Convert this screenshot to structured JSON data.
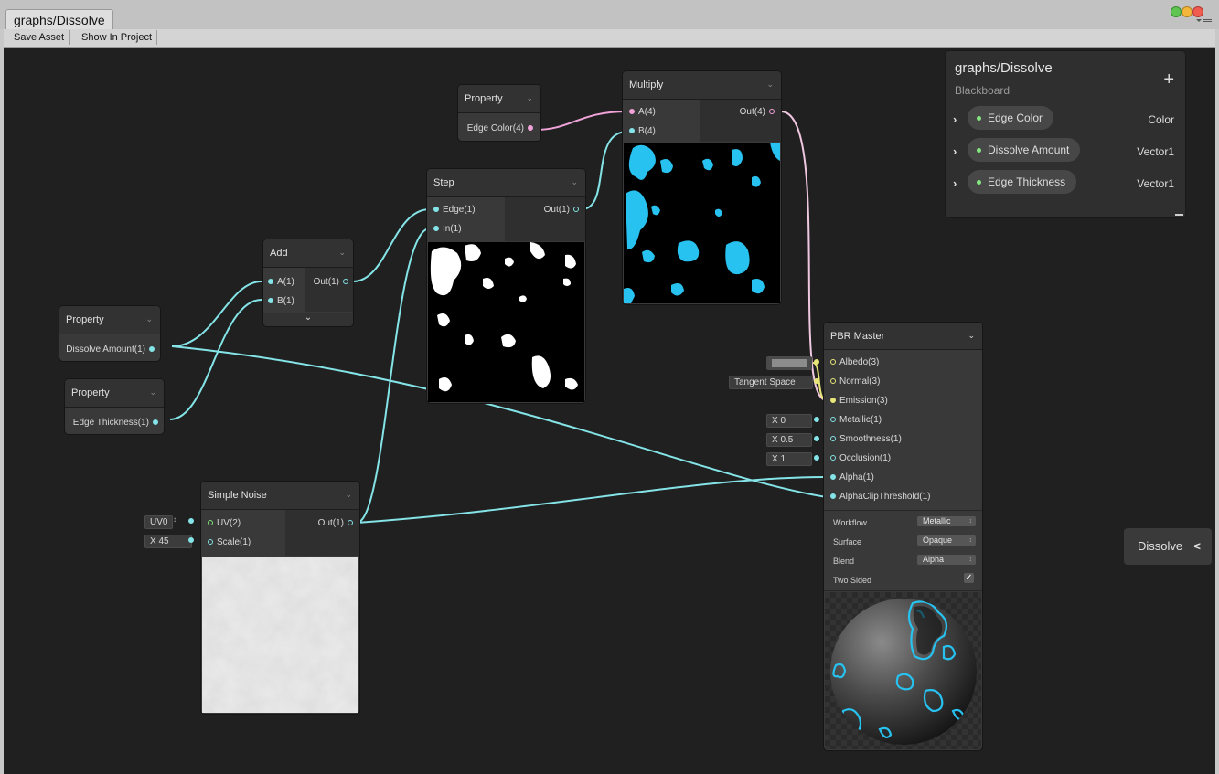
{
  "window": {
    "tab_title": "graphs/Dissolve",
    "controls": [
      "close-button",
      "minimize-button",
      "maximize-button"
    ]
  },
  "toolbar": {
    "save_asset": "Save Asset",
    "show_in_project": "Show In Project"
  },
  "nodes": {
    "property_edge_color": {
      "title": "Property",
      "output": "Edge Color(4)"
    },
    "property_dissolve_amount": {
      "title": "Property",
      "output": "Dissolve Amount(1)"
    },
    "property_edge_thickness": {
      "title": "Property",
      "output": "Edge Thickness(1)"
    },
    "add": {
      "title": "Add",
      "input_a": "A(1)",
      "input_b": "B(1)",
      "output": "Out(1)"
    },
    "step": {
      "title": "Step",
      "input_edge": "Edge(1)",
      "input_in": "In(1)",
      "output": "Out(1)"
    },
    "multiply": {
      "title": "Multiply",
      "input_a": "A(4)",
      "input_b": "B(4)",
      "output": "Out(4)"
    },
    "simple_noise": {
      "title": "Simple Noise",
      "input_uv": "UV(2)",
      "input_scale": "Scale(1)",
      "output": "Out(1)",
      "uv_value": "UV0",
      "scale_value": "X  45"
    },
    "pbr_master": {
      "title": "PBR Master",
      "inputs": [
        "Albedo(3)",
        "Normal(3)",
        "Emission(3)",
        "Metallic(1)",
        "Smoothness(1)",
        "Occlusion(1)",
        "Alpha(1)",
        "AlphaClipThreshold(1)"
      ],
      "normal_value": "Tangent Space",
      "metallic_value": "X  0",
      "smoothness_value": "X  0.5",
      "occlusion_value": "X  1",
      "options": [
        {
          "label": "Workflow",
          "value": "Metallic"
        },
        {
          "label": "Surface",
          "value": "Opaque"
        },
        {
          "label": "Blend",
          "value": "Alpha"
        },
        {
          "label": "Two Sided",
          "value": "checked"
        }
      ]
    }
  },
  "blackboard": {
    "title": "graphs/Dissolve",
    "subtitle": "Blackboard",
    "add_label": "+",
    "properties": [
      {
        "name": "Edge Color",
        "type": "Color"
      },
      {
        "name": "Dissolve Amount",
        "type": "Vector1"
      },
      {
        "name": "Edge Thickness",
        "type": "Vector1"
      }
    ]
  },
  "side_tab": {
    "label": "Dissolve",
    "arrow": "<"
  },
  "colors": {
    "canvas": "#202020",
    "node": "#393939",
    "wire_float": "#84e4e7",
    "wire_color": "#f0a3d9",
    "wire_vector3": "#e8e678",
    "dissolve_edge": "#27c2f0"
  }
}
